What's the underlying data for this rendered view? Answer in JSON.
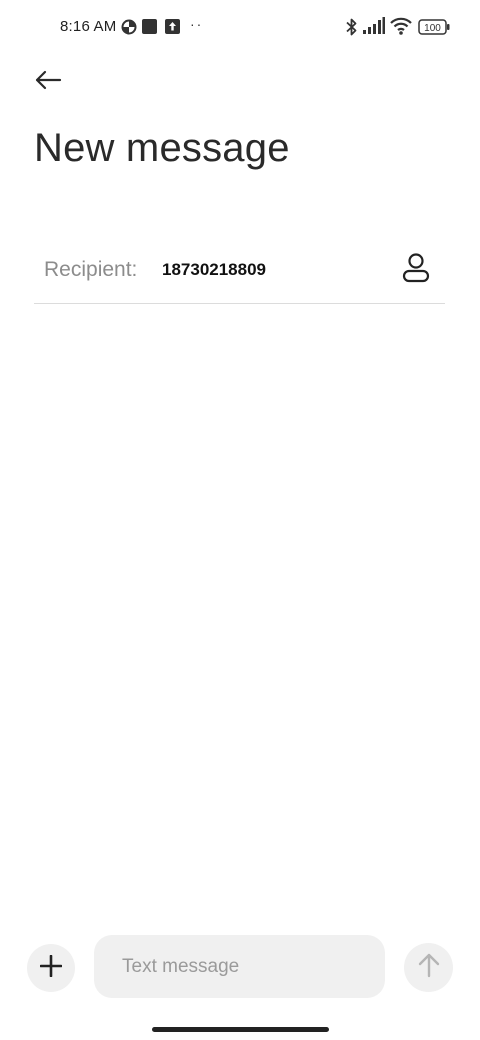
{
  "status_bar": {
    "time": "8:16 AM",
    "dots": "··",
    "battery": "100",
    "left_icons": [
      "data-saver-icon",
      "square-notification-icon",
      "upload-notification-icon"
    ],
    "right_icons": [
      "bluetooth-icon",
      "signal-icon",
      "wifi-icon",
      "battery-icon"
    ]
  },
  "header": {
    "back_icon": "back-arrow-icon",
    "title": "New message"
  },
  "recipient": {
    "label": "Recipient:",
    "value": "18730218809",
    "contact_icon": "contact-person-icon"
  },
  "compose": {
    "placeholder": "Text message",
    "add_icon": "plus-icon",
    "send_icon": "send-arrow-up-icon"
  },
  "colors": {
    "background": "#ffffff",
    "field_background": "#f0f0f0",
    "placeholder": "#9a9a9a",
    "label": "#8c8c8c",
    "divider": "#dcdcdc"
  }
}
